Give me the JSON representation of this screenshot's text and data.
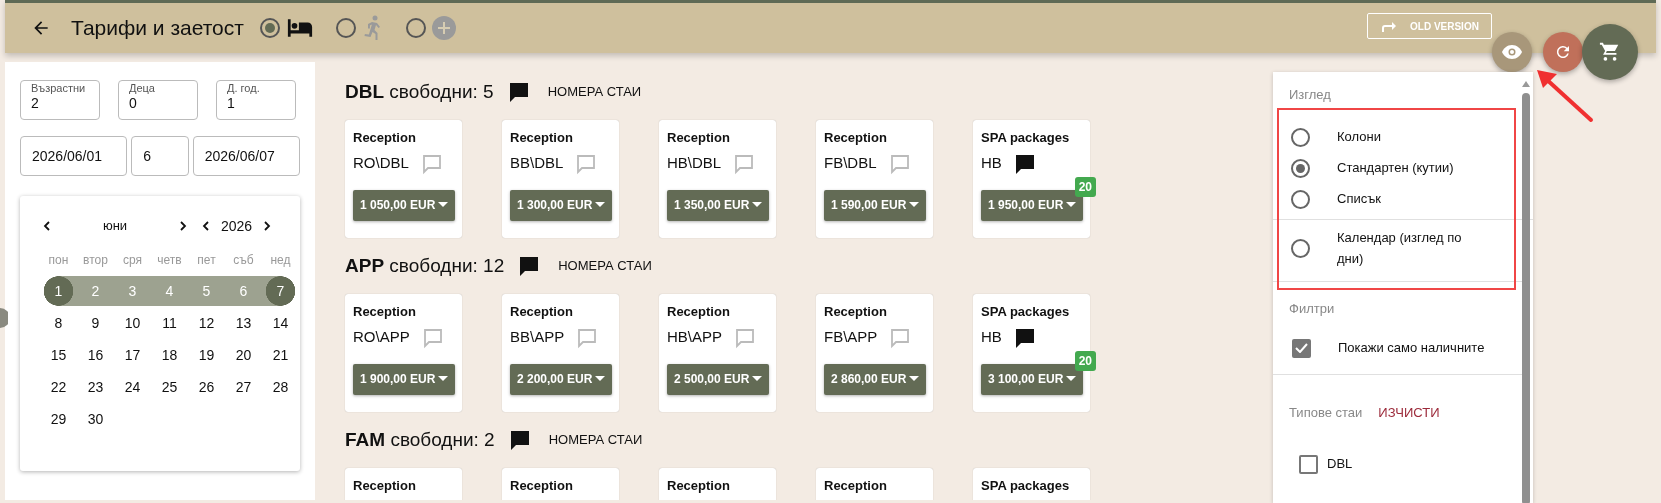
{
  "header": {
    "title": "Тарифи и заетост",
    "old_version": "OLD VERSION",
    "modes": [
      {
        "kind": "bed",
        "selected": true,
        "disabled": false
      },
      {
        "kind": "walk",
        "selected": false,
        "disabled": true
      },
      {
        "kind": "plus",
        "selected": false,
        "disabled": true
      }
    ]
  },
  "guests": [
    {
      "label": "Възрастни",
      "value": "2"
    },
    {
      "label": "Деца",
      "value": "0"
    },
    {
      "label": "Д. год.",
      "value": "1"
    }
  ],
  "dates": {
    "from": "2026/06/01",
    "nights": "6",
    "to": "2026/06/07"
  },
  "calendar": {
    "month": "юни",
    "year": "2026",
    "weekdays": [
      "пон",
      "втор",
      "сря",
      "четв",
      "пет",
      "съб",
      "нед"
    ],
    "days": [
      {
        "day": "1",
        "selected": true,
        "in_range": true
      },
      {
        "day": "2",
        "selected": false,
        "in_range": true
      },
      {
        "day": "3",
        "selected": false,
        "in_range": true
      },
      {
        "day": "4",
        "selected": false,
        "in_range": true
      },
      {
        "day": "5",
        "selected": false,
        "in_range": true
      },
      {
        "day": "6",
        "selected": false,
        "in_range": true
      },
      {
        "day": "7",
        "selected": true,
        "in_range": true
      },
      {
        "day": "8",
        "selected": false,
        "in_range": false
      },
      {
        "day": "9",
        "selected": false,
        "in_range": false
      },
      {
        "day": "10",
        "selected": false,
        "in_range": false
      },
      {
        "day": "11",
        "selected": false,
        "in_range": false
      },
      {
        "day": "12",
        "selected": false,
        "in_range": false
      },
      {
        "day": "13",
        "selected": false,
        "in_range": false
      },
      {
        "day": "14",
        "selected": false,
        "in_range": false
      },
      {
        "day": "15",
        "selected": false,
        "in_range": false
      },
      {
        "day": "16",
        "selected": false,
        "in_range": false
      },
      {
        "day": "17",
        "selected": false,
        "in_range": false
      },
      {
        "day": "18",
        "selected": false,
        "in_range": false
      },
      {
        "day": "19",
        "selected": false,
        "in_range": false
      },
      {
        "day": "20",
        "selected": false,
        "in_range": false
      },
      {
        "day": "21",
        "selected": false,
        "in_range": false
      },
      {
        "day": "22",
        "selected": false,
        "in_range": false
      },
      {
        "day": "23",
        "selected": false,
        "in_range": false
      },
      {
        "day": "24",
        "selected": false,
        "in_range": false
      },
      {
        "day": "25",
        "selected": false,
        "in_range": false
      },
      {
        "day": "26",
        "selected": false,
        "in_range": false
      },
      {
        "day": "27",
        "selected": false,
        "in_range": false
      },
      {
        "day": "28",
        "selected": false,
        "in_range": false
      },
      {
        "day": "29",
        "selected": false,
        "in_range": false
      },
      {
        "day": "30",
        "selected": false,
        "in_range": false
      }
    ]
  },
  "sections": [
    {
      "heading": "**DBL** свободни: 5",
      "rooms_link": "НОМЕРА СТАИ",
      "offers": [
        {
          "source": "Reception",
          "plan": "RO\\DBL",
          "has_note": false,
          "price": "1 050,00 EUR"
        },
        {
          "source": "Reception",
          "plan": "BB\\DBL",
          "has_note": false,
          "price": "1 300,00 EUR"
        },
        {
          "source": "Reception",
          "plan": "HB\\DBL",
          "has_note": false,
          "price": "1 350,00 EUR"
        },
        {
          "source": "Reception",
          "plan": "FB\\DBL",
          "has_note": false,
          "price": "1 590,00 EUR"
        },
        {
          "source": "SPA packages",
          "plan": "HB",
          "has_note": true,
          "price": "1 950,00 EUR",
          "badge": "20"
        }
      ]
    },
    {
      "heading": "**APP** свободни: 12",
      "rooms_link": "НОМЕРА СТАИ",
      "offers": [
        {
          "source": "Reception",
          "plan": "RO\\APP",
          "has_note": false,
          "price": "1 900,00 EUR"
        },
        {
          "source": "Reception",
          "plan": "BB\\APP",
          "has_note": false,
          "price": "2 200,00 EUR"
        },
        {
          "source": "Reception",
          "plan": "HB\\APP",
          "has_note": false,
          "price": "2 500,00 EUR"
        },
        {
          "source": "Reception",
          "plan": "FB\\APP",
          "has_note": false,
          "price": "2 860,00 EUR"
        },
        {
          "source": "SPA packages",
          "plan": "HB",
          "has_note": true,
          "price": "3 100,00 EUR",
          "badge": "20"
        }
      ]
    },
    {
      "heading": "**FAM** свободни: 2",
      "rooms_link": "НОМЕРА СТАИ",
      "offers": [
        {
          "source": "Reception"
        },
        {
          "source": "Reception"
        },
        {
          "source": "Reception"
        },
        {
          "source": "Reception"
        },
        {
          "source": "SPA packages"
        }
      ]
    }
  ],
  "view_panel": {
    "title": "Изглед",
    "options": [
      {
        "label": "Колони",
        "selected": false,
        "divider_before": false
      },
      {
        "label": "Стандартен (кутии)",
        "selected": true,
        "divider_before": false
      },
      {
        "label": "Списък",
        "selected": false,
        "divider_before": false
      },
      {
        "label": "Календар (изглед по дни)",
        "selected": false,
        "divider_before": true
      }
    ],
    "filters_title": "Филтри",
    "filters": [
      {
        "label": "Покажи само наличните",
        "checked": true
      }
    ],
    "room_types_title": "Типове стаи",
    "clear": "ИЗЧИСТИ",
    "room_types": [
      {
        "label": "DBL",
        "checked": false
      }
    ]
  }
}
